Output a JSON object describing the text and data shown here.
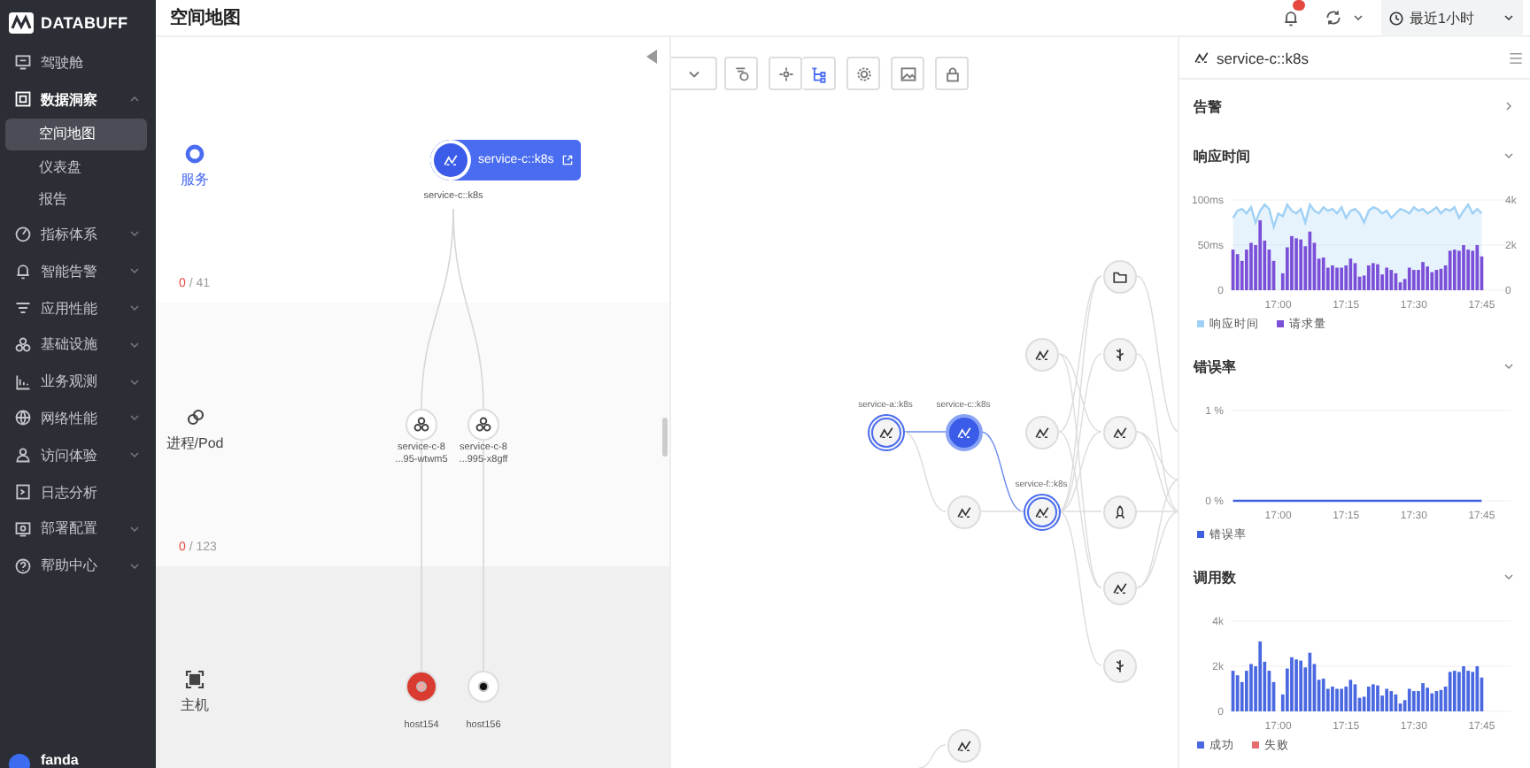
{
  "sidebar": {
    "logo": "DATABUFF",
    "items": [
      {
        "label": "驾驶舱",
        "kind": "link"
      },
      {
        "label": "数据洞察",
        "kind": "group",
        "expanded": true,
        "children": [
          {
            "label": "空间地图",
            "selected": true
          },
          {
            "label": "仪表盘",
            "selected": false
          },
          {
            "label": "报告",
            "selected": false
          }
        ]
      },
      {
        "label": "指标体系",
        "kind": "group",
        "expanded": false
      },
      {
        "label": "智能告警",
        "kind": "group",
        "expanded": false
      },
      {
        "label": "应用性能",
        "kind": "group",
        "expanded": false
      },
      {
        "label": "基础设施",
        "kind": "group",
        "expanded": false
      },
      {
        "label": "业务观测",
        "kind": "group",
        "expanded": false
      },
      {
        "label": "网络性能",
        "kind": "group",
        "expanded": false
      },
      {
        "label": "访问体验",
        "kind": "group",
        "expanded": false
      },
      {
        "label": "日志分析",
        "kind": "link"
      },
      {
        "label": "部署配置",
        "kind": "group",
        "expanded": false
      },
      {
        "label": "帮助中心",
        "kind": "group",
        "expanded": false
      }
    ],
    "user": {
      "name": "fanda"
    }
  },
  "header": {
    "title": "空间地图",
    "time_range": "最近1小时"
  },
  "space_map": {
    "layers": [
      {
        "label": "服务",
        "alerting": "0",
        "of_total": "/ 41"
      },
      {
        "label": "进程/Pod",
        "alerting": "0",
        "of_total": "/ 123"
      },
      {
        "label": "主机"
      }
    ],
    "service_node": {
      "name": "service-c::k8s",
      "caption": "service-c::k8s"
    },
    "pods": [
      {
        "line1": "service-c-8",
        "line2": "...95-wtwm5"
      },
      {
        "line1": "service-c-8",
        "line2": "...995-x8gff"
      }
    ],
    "hosts": [
      {
        "name": "host154",
        "alert": true
      },
      {
        "name": "host156",
        "alert": false
      }
    ]
  },
  "graph": {
    "toolbar": [
      {
        "selected": false
      },
      {
        "selected": false
      },
      {
        "selected": false
      },
      {
        "selected": true
      },
      {
        "selected": false
      },
      {
        "selected": false
      },
      {
        "selected": false
      }
    ],
    "nodes": [
      {
        "kind": "focus",
        "label": "service-a::k8s"
      },
      {
        "kind": "current",
        "label": "service-c::k8s"
      },
      {
        "kind": "plain"
      },
      {
        "kind": "focus",
        "label": "service-f::k8s"
      },
      {
        "kind": "plain"
      },
      {
        "kind": "plain"
      },
      {
        "kind": "plain"
      },
      {
        "kind": "plain"
      },
      {
        "kind": "plain"
      },
      {
        "kind": "plain"
      },
      {
        "kind": "plain"
      },
      {
        "kind": "plain"
      },
      {
        "kind": "plain"
      }
    ]
  },
  "detail": {
    "title": "service-c::k8s",
    "sections": [
      {
        "title": "告警",
        "expanded": false
      },
      {
        "title": "响应时间",
        "expanded": true,
        "chart_data": {
          "type": "bar",
          "legend": "bottom",
          "categories": [
            null,
            null,
            null,
            null,
            null,
            null,
            null,
            null,
            null,
            null,
            "17:00",
            null,
            null,
            null,
            null,
            null,
            null,
            null,
            null,
            null,
            null,
            null,
            null,
            null,
            null,
            "17:15",
            null,
            null,
            null,
            null,
            null,
            null,
            null,
            null,
            null,
            null,
            null,
            null,
            null,
            null,
            "17:30",
            null,
            null,
            null,
            null,
            null,
            null,
            null,
            null,
            null,
            null,
            null,
            null,
            null,
            null,
            "17:45"
          ],
          "ylim": [
            0,
            100
          ],
          "yticks": [
            {
              "value": 0,
              "label": "0"
            },
            {
              "value": 50,
              "label": "50ms"
            },
            {
              "value": 100,
              "label": "100ms"
            }
          ],
          "y2lim": [
            0,
            4000
          ],
          "y2ticks": [
            {
              "value": 0,
              "label": "0"
            },
            {
              "value": 2000,
              "label": "2k"
            },
            {
              "value": 4000,
              "label": "4k"
            }
          ],
          "series": [
            {
              "name": "响应时间",
              "color": "#9fd0f5",
              "type": "line",
              "values": [
                80,
                88,
                90,
                85,
                92,
                75,
                88,
                95,
                90,
                70,
                85,
                82,
                95,
                88,
                85,
                90,
                75,
                95,
                88,
                85,
                92,
                88,
                90,
                85,
                92,
                80,
                88,
                90,
                85,
                75,
                88,
                92,
                90,
                85,
                88,
                80,
                85,
                90,
                88,
                85,
                92,
                88,
                90,
                85,
                88,
                92,
                85,
                90,
                88,
                92,
                80,
                88,
                95,
                85,
                90,
                85
              ]
            },
            {
              "name": "请求量",
              "color": "#7b4fd8",
              "type": "bar",
              "axis": "y2",
              "values": [
                1800,
                1600,
                1300,
                1800,
                2100,
                2000,
                3100,
                2200,
                1800,
                1300,
                null,
                750,
                1900,
                2400,
                2300,
                2250,
                1950,
                2600,
                2100,
                1400,
                1450,
                1000,
                1100,
                1000,
                1000,
                1100,
                1400,
                1200,
                600,
                650,
                1100,
                1200,
                1150,
                700,
                1000,
                900,
                750,
                350,
                500,
                1000,
                900,
                900,
                1250,
                1050,
                800,
                900,
                950,
                1100,
                1750,
                1800,
                1750,
                2000,
                1800,
                1750,
                2000,
                1500
              ]
            }
          ]
        }
      },
      {
        "title": "错误率",
        "expanded": true,
        "chart_data": {
          "type": "line",
          "legend": "bottom",
          "categories": [
            null,
            null,
            null,
            null,
            null,
            null,
            null,
            null,
            null,
            null,
            "17:00",
            null,
            null,
            null,
            null,
            null,
            null,
            null,
            null,
            null,
            null,
            null,
            null,
            null,
            null,
            "17:15",
            null,
            null,
            null,
            null,
            null,
            null,
            null,
            null,
            null,
            null,
            null,
            null,
            null,
            null,
            "17:30",
            null,
            null,
            null,
            null,
            null,
            null,
            null,
            null,
            null,
            null,
            null,
            null,
            null,
            null,
            "17:45"
          ],
          "ylim": [
            0,
            1
          ],
          "yticks": [
            {
              "value": 0,
              "label": "0 %"
            },
            {
              "value": 1,
              "label": "1 %"
            }
          ],
          "series": [
            {
              "name": "错误率",
              "color": "#3e5fe0",
              "values": [
                0,
                0,
                0,
                0,
                0,
                0,
                0,
                0,
                0,
                0,
                0,
                0,
                0,
                0,
                0,
                0,
                0,
                0,
                0,
                0,
                0,
                0,
                0,
                0,
                0,
                0,
                0,
                0,
                0,
                0,
                0,
                0,
                0,
                0,
                0,
                0,
                0,
                0,
                0,
                0,
                0,
                0,
                0,
                0,
                0,
                0,
                0,
                0,
                0,
                0,
                0,
                0,
                0,
                0,
                0,
                0
              ]
            }
          ]
        }
      },
      {
        "title": "调用数",
        "expanded": true,
        "chart_data": {
          "type": "bar",
          "legend": "bottom",
          "categories": [
            null,
            null,
            null,
            null,
            null,
            null,
            null,
            null,
            null,
            null,
            "17:00",
            null,
            null,
            null,
            null,
            null,
            null,
            null,
            null,
            null,
            null,
            null,
            null,
            null,
            null,
            "17:15",
            null,
            null,
            null,
            null,
            null,
            null,
            null,
            null,
            null,
            null,
            null,
            null,
            null,
            null,
            "17:30",
            null,
            null,
            null,
            null,
            null,
            null,
            null,
            null,
            null,
            null,
            null,
            null,
            null,
            null,
            "17:45"
          ],
          "ylim": [
            0,
            4000
          ],
          "yticks": [
            {
              "value": 0,
              "label": "0"
            },
            {
              "value": 2000,
              "label": "2k"
            },
            {
              "value": 4000,
              "label": "4k"
            }
          ],
          "series": [
            {
              "name": "成功",
              "color": "#4a68e0",
              "values": [
                1800,
                1600,
                1300,
                1800,
                2100,
                2000,
                3100,
                2200,
                1800,
                1300,
                null,
                750,
                1900,
                2400,
                2300,
                2250,
                1950,
                2600,
                2100,
                1400,
                1450,
                1000,
                1100,
                1000,
                1000,
                1100,
                1400,
                1200,
                600,
                650,
                1100,
                1200,
                1150,
                700,
                1000,
                900,
                750,
                350,
                500,
                1000,
                900,
                900,
                1250,
                1050,
                800,
                900,
                950,
                1100,
                1750,
                1800,
                1750,
                2000,
                1800,
                1750,
                2000,
                1500
              ]
            },
            {
              "name": "失败",
              "color": "#e66d6d",
              "values": [
                0,
                0,
                0,
                0,
                0,
                0,
                0,
                0,
                0,
                0,
                null,
                0,
                0,
                0,
                0,
                0,
                0,
                0,
                0,
                0,
                0,
                0,
                0,
                0,
                0,
                0,
                0,
                0,
                0,
                0,
                0,
                0,
                0,
                0,
                0,
                0,
                0,
                0,
                0,
                0,
                0,
                0,
                0,
                0,
                0,
                0,
                0,
                0,
                0,
                0,
                0,
                0,
                0,
                0,
                0,
                0
              ]
            }
          ]
        }
      }
    ]
  }
}
